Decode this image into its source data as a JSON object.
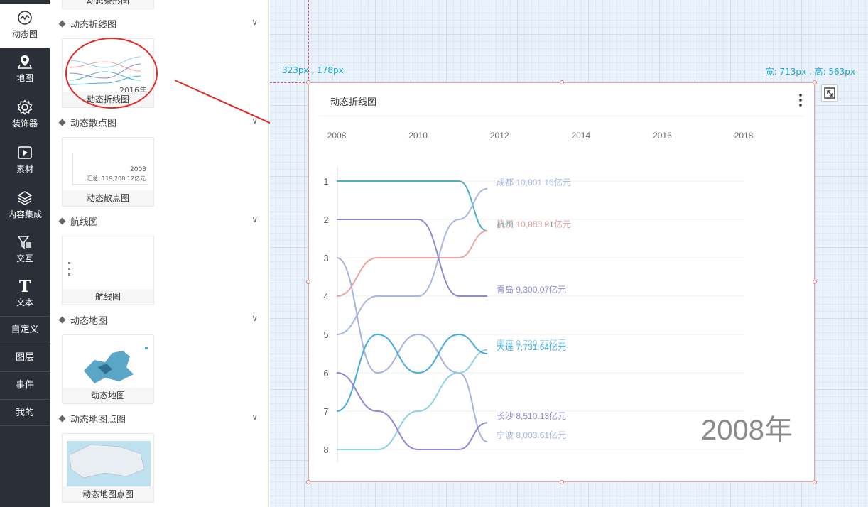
{
  "nav": {
    "items": [
      {
        "label": "动态图",
        "icon": "dynamic-chart-icon"
      },
      {
        "label": "地图",
        "icon": "map-pin-icon"
      },
      {
        "label": "装饰器",
        "icon": "gear-icon"
      },
      {
        "label": "素材",
        "icon": "play-icon"
      },
      {
        "label": "内容集成",
        "icon": "layers-icon"
      },
      {
        "label": "交互",
        "icon": "filter-icon"
      },
      {
        "label": "文本",
        "icon": "text-icon"
      }
    ],
    "text_items": [
      "自定义",
      "图层",
      "事件",
      "我的"
    ]
  },
  "panel": {
    "top_card_caption": "动态条形图",
    "sections": [
      {
        "title": "动态折线图",
        "card_caption": "动态折线图",
        "card_overlay": "2016年"
      },
      {
        "title": "动态散点图",
        "card_caption": "动态散点图",
        "card_overlay": "2008",
        "card_overlay2": "汇总: 119,208.12亿元"
      },
      {
        "title": "航线图",
        "card_caption": "航线图"
      },
      {
        "title": "动态地图",
        "card_caption": "动态地图"
      },
      {
        "title": "动态地图点图",
        "card_caption": "动态地图点图"
      }
    ]
  },
  "canvas": {
    "position_label": "323px , 178px",
    "size_label": "宽: 713px , 高: 563px"
  },
  "widget": {
    "title": "动态折线图",
    "year_watermark": "2008年"
  },
  "chart_data": {
    "type": "line",
    "title": "动态折线图",
    "x_axis_ticks": [
      "2008",
      "2010",
      "2012",
      "2014",
      "2016",
      "2018"
    ],
    "y_axis_ticks": [
      "1",
      "2",
      "3",
      "4",
      "5",
      "6",
      "7",
      "8"
    ],
    "y_inverted": true,
    "x": [
      2008,
      2009,
      2010,
      2011,
      2011.7
    ],
    "series": [
      {
        "name": "杭州",
        "color": "#4db2bd",
        "values": [
          1,
          1,
          1,
          1,
          2.3
        ],
        "label": "杭州 10,050.21亿元"
      },
      {
        "name": "武汉",
        "color": "#f0a3a0",
        "values": [
          4,
          3,
          3,
          3,
          2.3
        ],
        "label": "武汉 10,905.60亿元"
      },
      {
        "name": "成都",
        "color": "#a9b7e1",
        "values": [
          5,
          4,
          4,
          2,
          1.2
        ],
        "label": "成都 10,801.16亿元"
      },
      {
        "name": "青岛",
        "color": "#8d8bd4",
        "values": [
          2,
          2,
          2,
          4,
          4
        ],
        "label": "青岛 9,300.07亿元"
      },
      {
        "name": "宁波",
        "color": "#a6b2df",
        "values": [
          3,
          6,
          5,
          6,
          7.8
        ],
        "label": "宁波 8,003.61亿元"
      },
      {
        "name": "南京",
        "color": "#8ed2e6",
        "values": [
          8,
          8,
          7,
          6,
          5.4
        ],
        "label": "南京 9,720.77亿元"
      },
      {
        "name": "大连",
        "color": "#45ace0",
        "values": [
          7,
          5,
          6,
          5,
          5.5
        ],
        "label": "大连 7,731.64亿元"
      },
      {
        "name": "长沙",
        "color": "#8f88d6",
        "values": [
          6,
          7,
          8,
          8,
          7.3
        ],
        "label": "长沙 8,510.13亿元"
      }
    ]
  }
}
